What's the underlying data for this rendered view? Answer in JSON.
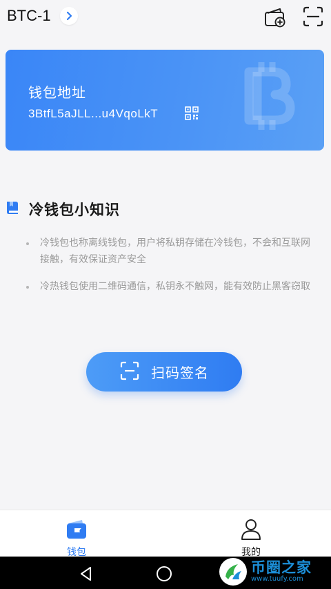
{
  "header": {
    "wallet_name": "BTC-1",
    "icons": [
      "chevron-right-icon",
      "wallet-add-icon",
      "scan-icon"
    ]
  },
  "card": {
    "title": "钱包地址",
    "address": "3BtfL5aJLL...u4VqoLkT",
    "icons": [
      "qr-code-icon",
      "bitcoin-watermark-icon"
    ]
  },
  "tips": {
    "title": "冷钱包小知识",
    "items": [
      "冷钱包也称离线钱包，用户将私钥存储在冷钱包，不会和互联网接触，有效保证资产安全",
      "冷热钱包使用二维码通信，私钥永不触网，能有效防止黑客窃取"
    ]
  },
  "scan_button": {
    "label": "扫码签名"
  },
  "tabbar": {
    "items": [
      {
        "label": "钱包",
        "icon": "wallet-icon",
        "active": true
      },
      {
        "label": "我的",
        "icon": "person-icon",
        "active": false
      }
    ]
  },
  "watermark": {
    "main": "币圈之家",
    "sub": "www.tuufy.com"
  },
  "colors": {
    "accent": "#3a86f7",
    "text_primary": "#1a1a1a",
    "text_muted": "#9a9a9a",
    "tab_active": "#2f7cf2",
    "tab_inactive": "#222222",
    "background": "#f5f5f7"
  }
}
